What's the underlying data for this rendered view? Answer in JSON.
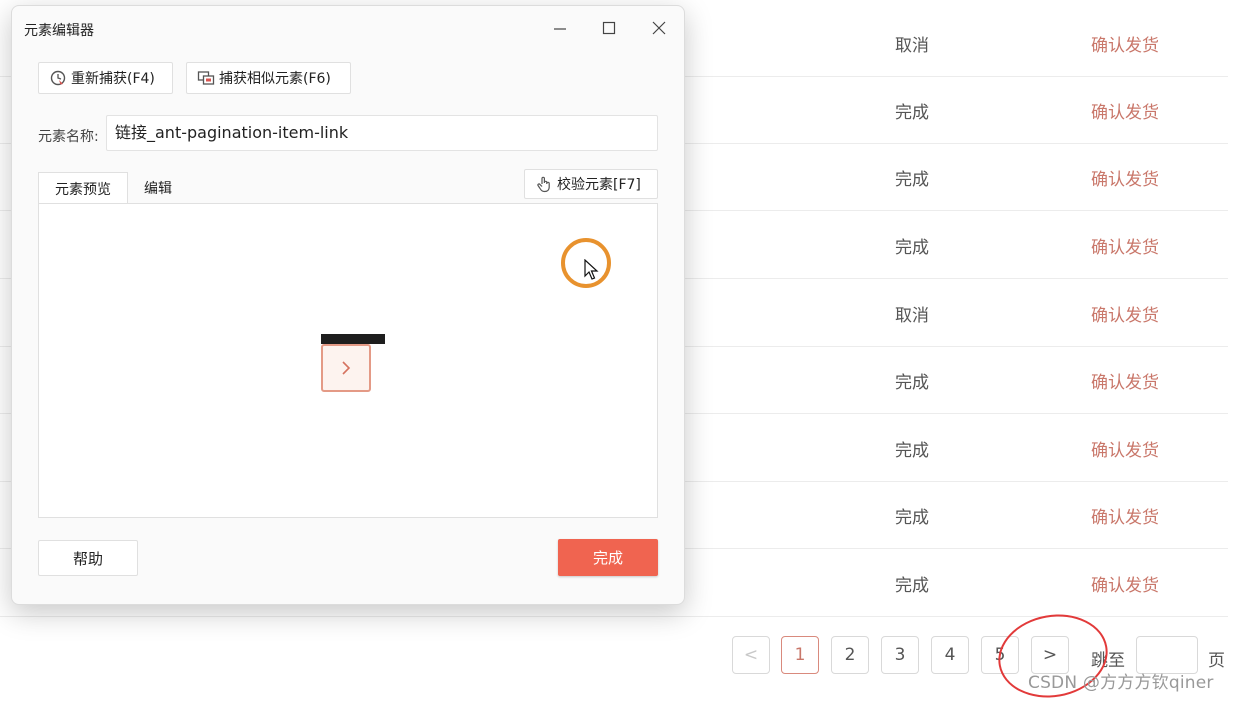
{
  "background_table": {
    "rows": [
      {
        "status": "取消",
        "action": "确认发货"
      },
      {
        "status": "完成",
        "action": "确认发货"
      },
      {
        "status": "完成",
        "action": "确认发货"
      },
      {
        "status": "完成",
        "action": "确认发货"
      },
      {
        "status": "取消",
        "action": "确认发货"
      },
      {
        "status": "完成",
        "action": "确认发货"
      },
      {
        "status": "完成",
        "action": "确认发货"
      },
      {
        "status": "完成",
        "action": "确认发货"
      },
      {
        "status": "完成",
        "action": "确认发货"
      }
    ]
  },
  "pagination": {
    "pages": [
      "1",
      "2",
      "3",
      "4",
      "5"
    ],
    "active_page": "1",
    "prev_symbol": "<",
    "next_symbol": ">",
    "jump_label": "跳至",
    "page_suffix": "页"
  },
  "watermark": "CSDN @方方方钦qiner",
  "dialog": {
    "title": "元素编辑器",
    "toolbar": {
      "recapture_label": "重新捕获(F4)",
      "capture_similar_label": "捕获相似元素(F6)"
    },
    "name_field": {
      "label": "元素名称:",
      "value": "链接_ant-pagination-item-link"
    },
    "tabs": [
      {
        "label": "元素预览"
      },
      {
        "label": "编辑"
      }
    ],
    "verify_label": "校验元素[F7]",
    "help_label": "帮助",
    "done_label": "完成"
  },
  "colors": {
    "accent": "#f06450",
    "link": "#c9776a",
    "annotation": "#e23a3a"
  }
}
